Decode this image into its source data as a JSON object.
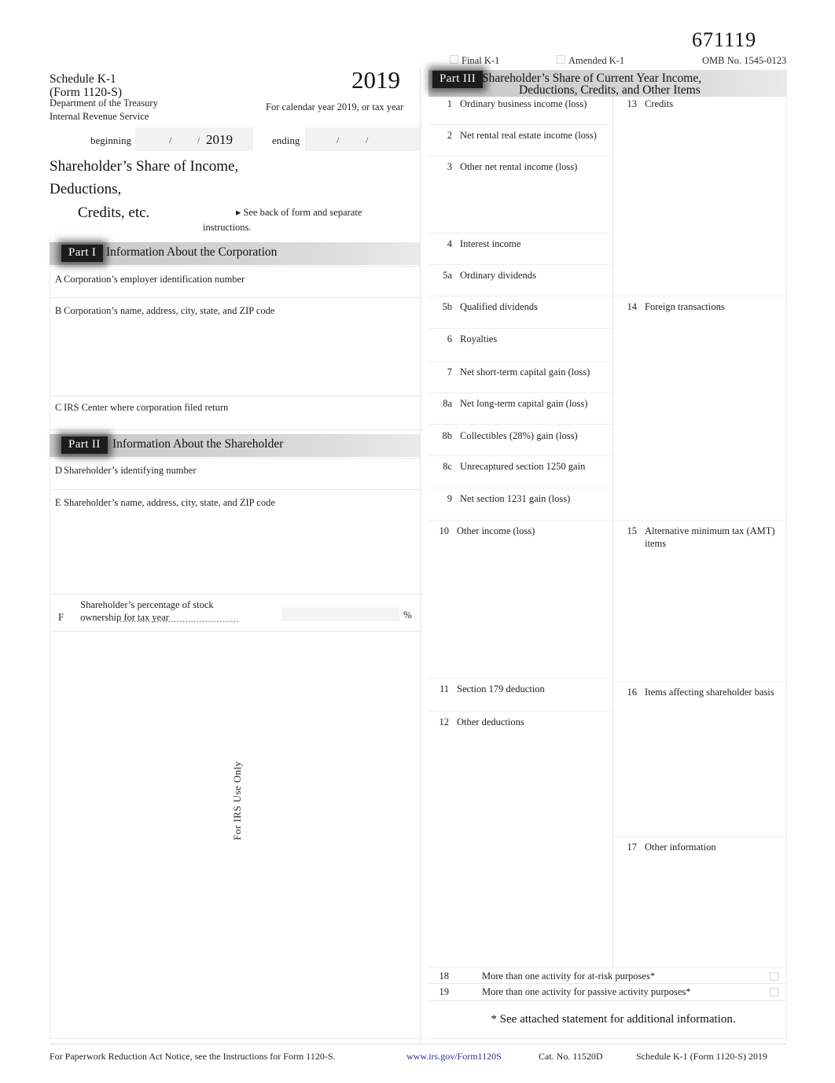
{
  "form": {
    "form_number_code": "671119",
    "omb": "OMB No. 1545-0123",
    "final_k1": "Final K-1",
    "amended_k1": "Amended K-1",
    "schedule_line1": "Schedule K-1",
    "schedule_line2": "(Form 1120-S)",
    "dept_line1": "Department of the Treasury",
    "dept_line2": "Internal Revenue Service",
    "year_big": "2019",
    "calendar_year_text": "For calendar year 2019, or tax year",
    "beginning_label": "beginning",
    "ending_label": "ending",
    "beginning_year": "2019",
    "slash": "/",
    "main_title_line1": "Shareholder’s Share of Income,",
    "main_title_line2": "Deductions,",
    "main_title_line3": "Credits, etc.",
    "see_back": "▸ See back of form and separate",
    "see_back_2": "instructions.",
    "irs_use_only": "For IRS Use Only"
  },
  "part1": {
    "chip": "Part I",
    "title": "Information About the Corporation",
    "fields": [
      {
        "letter": "A",
        "label": "Corporation’s employer identification number"
      },
      {
        "letter": "B",
        "label": "Corporation’s name, address, city, state, and ZIP code"
      },
      {
        "letter": "C",
        "label": "IRS Center where corporation filed return"
      }
    ]
  },
  "part2": {
    "chip": "Part II",
    "title": "Information About the Shareholder",
    "fields": [
      {
        "letter": "D",
        "label": "Shareholder’s identifying number"
      },
      {
        "letter": "E",
        "label": "Shareholder’s name, address, city, state, and ZIP code"
      }
    ],
    "f_letter": "F",
    "f_label_line1": "Shareholder’s percentage of stock",
    "f_label_line2": "ownership for tax year",
    "f_dots": "..........................................",
    "percent_sign": "%"
  },
  "part3": {
    "chip": "Part III",
    "title_line1": "Shareholder’s Share of Current Year Income,",
    "title_line2": "Deductions, Credits, and Other Items",
    "left_items": [
      {
        "num": "1",
        "label": "Ordinary business income (loss)"
      },
      {
        "num": "2",
        "label": "Net rental real estate income (loss)"
      },
      {
        "num": "3",
        "label": "Other net rental income (loss)"
      },
      {
        "num": "4",
        "label": "Interest income"
      },
      {
        "num": "5a",
        "label": "Ordinary dividends"
      },
      {
        "num": "5b",
        "label": "Qualified dividends"
      },
      {
        "num": "6",
        "label": "Royalties"
      },
      {
        "num": "7",
        "label": "Net short-term capital gain (loss)"
      },
      {
        "num": "8a",
        "label": "Net long-term capital gain (loss)"
      },
      {
        "num": "8b",
        "label": "Collectibles (28%) gain (loss)"
      },
      {
        "num": "8c",
        "label": "Unrecaptured section 1250 gain"
      },
      {
        "num": "9",
        "label": "Net section 1231 gain (loss)"
      },
      {
        "num": "10",
        "label": "Other income (loss)"
      },
      {
        "num": "11",
        "label": "Section 179 deduction"
      },
      {
        "num": "12",
        "label": "Other deductions"
      }
    ],
    "right_items": [
      {
        "num": "13",
        "label": "Credits"
      },
      {
        "num": "14",
        "label": "Foreign transactions"
      },
      {
        "num": "15",
        "label": "Alternative minimum tax (AMT)\nitems"
      },
      {
        "num": "16",
        "label": "Items affecting shareholder basis"
      },
      {
        "num": "17",
        "label": "Other information"
      }
    ],
    "foot_items": [
      {
        "num": "18",
        "label": "More than one activity for at-risk purposes*"
      },
      {
        "num": "19",
        "label": "More than one activity for passive activity purposes*"
      }
    ],
    "attached_note": "* See attached statement for additional information."
  },
  "footer": {
    "paperwork": "For Paperwork Reduction Act Notice, see the Instructions for Form 1120-S.",
    "url": "www.irs.gov/Form1120S",
    "cat_no": "Cat. No. 11520D",
    "schedule_ref": "Schedule K-1 (Form 1120-S) 2019"
  },
  "colors": {
    "band": "#cfcfcf",
    "chip": "#1c1c1c",
    "link": "#2b2f9e",
    "rule": "#e8e8e8"
  }
}
